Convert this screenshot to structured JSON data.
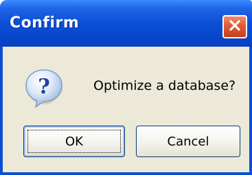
{
  "dialog": {
    "title": "Confirm",
    "message": "Optimize a database?",
    "icon": "question-icon",
    "buttons": {
      "ok_label": "OK",
      "cancel_label": "Cancel"
    }
  },
  "colors": {
    "titlebar": "#0a4fd6",
    "close_button": "#e05a34",
    "client_background": "#ece9d8"
  }
}
